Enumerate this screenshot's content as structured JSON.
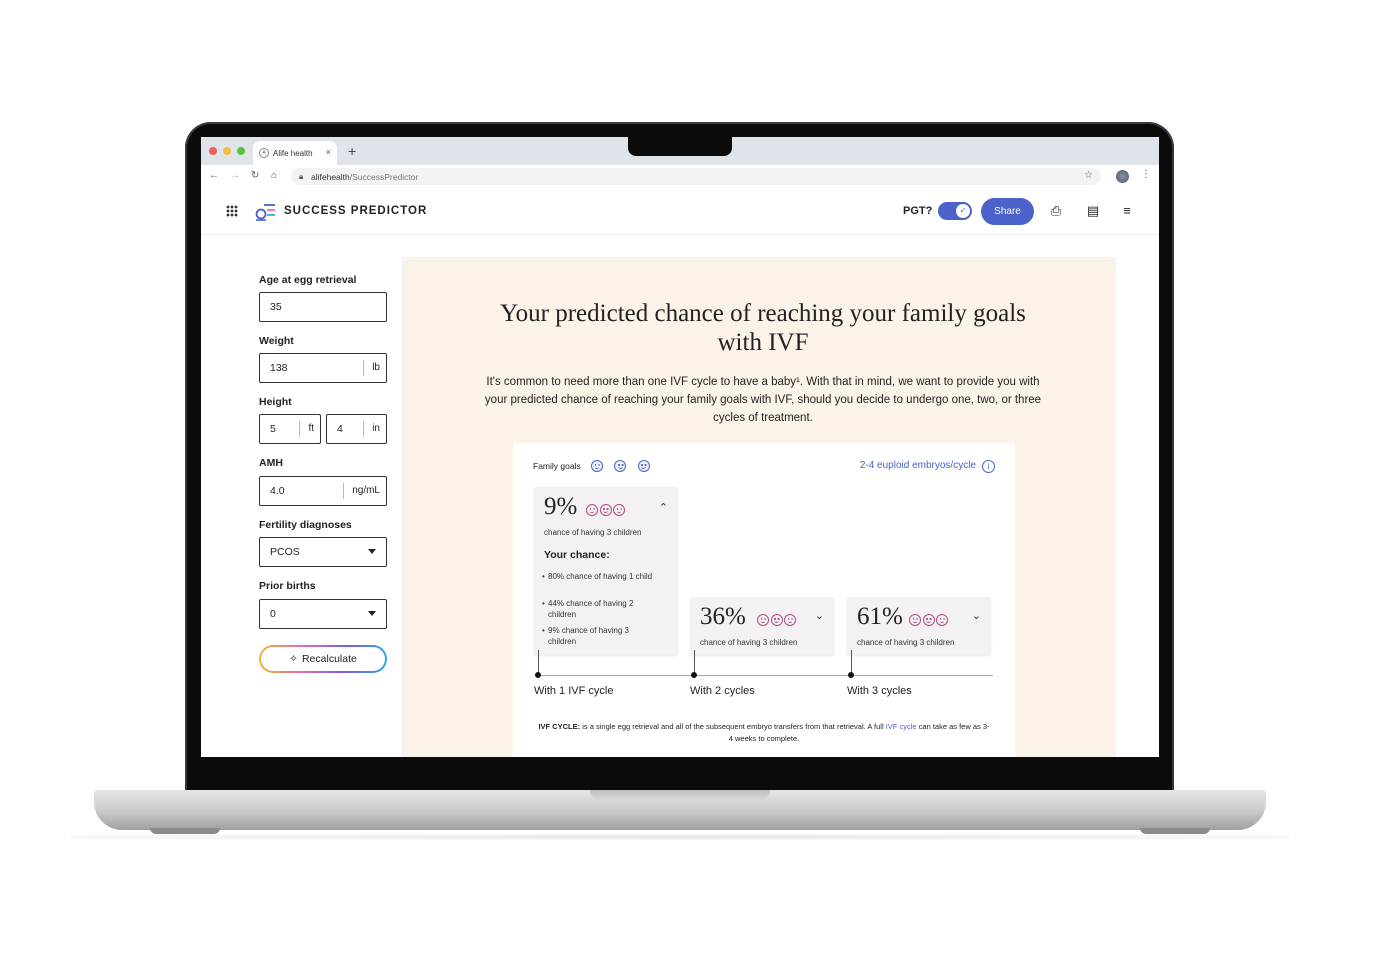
{
  "browser": {
    "tab_title": "Alife health",
    "tab_close": "×",
    "new_tab": "+",
    "url_domain": "alifehealth",
    "url_path": "/SuccessPredictor"
  },
  "header": {
    "brand": "SUCCESS PREDICTOR",
    "pgt_label": "PGT?",
    "share_label": "Share"
  },
  "form": {
    "age": {
      "label": "Age at egg retrieval",
      "value": "35"
    },
    "weight": {
      "label": "Weight",
      "value": "138",
      "unit": "lb"
    },
    "height": {
      "label": "Height",
      "feet": "5",
      "feet_unit": "ft",
      "inches": "4",
      "inches_unit": "in"
    },
    "amh": {
      "label": "AMH",
      "value": "4.0",
      "unit": "ng/mL"
    },
    "diagnoses": {
      "label": "Fertility diagnoses",
      "value": "PCOS"
    },
    "prior_births": {
      "label": "Prior births",
      "value": "0"
    },
    "recalculate_label": "Recalculate"
  },
  "main": {
    "title_line1": "Your predicted chance of reaching your family goals",
    "title_line2": "with IVF",
    "intro": "It's common to need more than one IVF cycle to have a baby¹. With that in mind, we want to provide you with your predicted chance of reaching your family goals with IVF, should you decide to undergo one, two, or three cycles of treatment.",
    "family_goals_label": "Family goals",
    "embryos_label": "2-4 euploid embryos/cycle",
    "info_glyph": "i",
    "results": [
      {
        "percent": "9%",
        "subtitle": "chance of having 3 children",
        "expanded": true,
        "your_chance_label": "Your chance:",
        "bullets": [
          "80% chance of having 1 child",
          "44% chance of having 2 children",
          "9% chance of having 3 children"
        ],
        "cycle_label": "With 1 IVF cycle"
      },
      {
        "percent": "36%",
        "subtitle": "chance of having 3 children",
        "expanded": false,
        "cycle_label": "With 2 cycles"
      },
      {
        "percent": "61%",
        "subtitle": "chance of having 3 children",
        "expanded": false,
        "cycle_label": "With 3 cycles"
      }
    ],
    "footnote_bold": "IVF CYCLE:",
    "footnote_text": " is a single egg retrieval and all of the subsequent embryo transfers from that retrieval. A full ",
    "footnote_link": "IVF cycle",
    "footnote_tail": " can take as few as 3-4 weeks to complete."
  },
  "colors": {
    "accent": "#4a62c9",
    "panel": "#fbf3e7",
    "face": "#b1487f"
  }
}
